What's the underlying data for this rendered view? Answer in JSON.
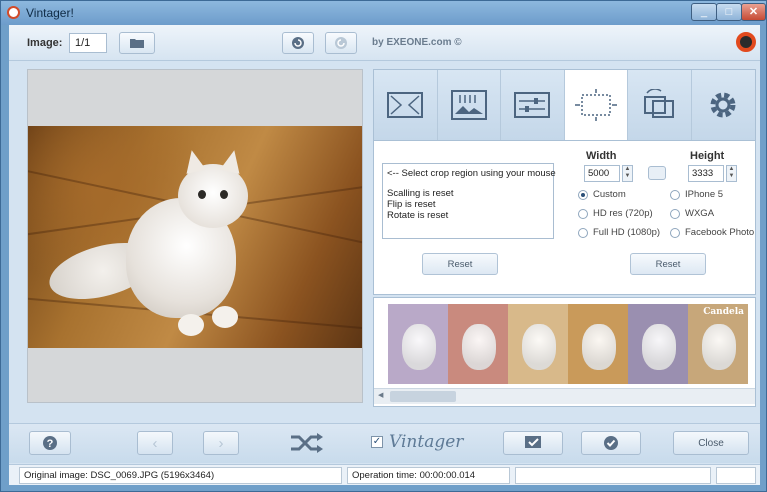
{
  "window": {
    "title": "Vintager!"
  },
  "toolbar": {
    "image_label": "Image:",
    "image_counter": "1/1",
    "byline": "by EXEONE.com ©"
  },
  "tabs": [
    {
      "name": "frame",
      "active": false
    },
    {
      "name": "picture-frame",
      "active": false
    },
    {
      "name": "adjust",
      "active": false
    },
    {
      "name": "crop",
      "active": true
    },
    {
      "name": "rotate",
      "active": false
    },
    {
      "name": "settings",
      "active": false
    }
  ],
  "crop": {
    "messages": [
      "<-- Select crop region using your mouse",
      "Scalling is reset",
      "Flip is reset",
      "Rotate is reset"
    ],
    "width_label": "Width",
    "height_label": "Height",
    "width_value": "5000",
    "height_value": "3333",
    "presets_left": [
      {
        "label": "Custom",
        "selected": true
      },
      {
        "label": "HD res (720p)",
        "selected": false
      },
      {
        "label": "Full HD (1080p)",
        "selected": false
      }
    ],
    "presets_right": [
      {
        "label": "IPhone 5",
        "selected": false
      },
      {
        "label": "WXGA",
        "selected": false
      },
      {
        "label": "Facebook Photo",
        "selected": false
      }
    ],
    "reset_left": "Reset",
    "reset_right": "Reset"
  },
  "filmstrip": {
    "selected_label": "Candela",
    "tints": [
      "#b9a9c8",
      "#c98a7e",
      "#d8b98a",
      "#c99a5a",
      "#9a8fb0",
      "#c7a77a"
    ]
  },
  "bottom": {
    "help_icon": "help-icon",
    "vintager_label": "Vintager",
    "vintager_checked": true,
    "close_label": "Close"
  },
  "status": {
    "original": "Original image: DSC_0069.JPG (5196x3464)",
    "operation_time": "Operation time: 00:00:00.014"
  },
  "colors": {
    "accent": "#e24a1e",
    "frame": "#6f9fc9"
  }
}
